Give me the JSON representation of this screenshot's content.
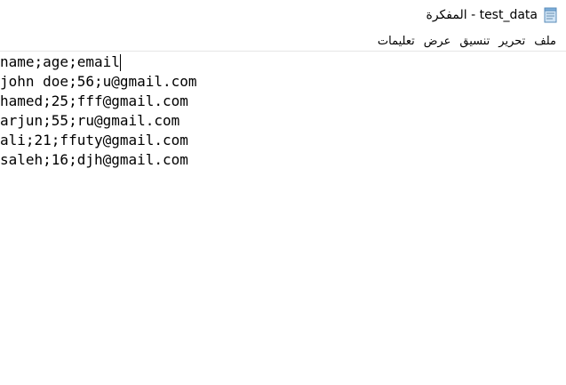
{
  "window": {
    "title": "test_data - المفكرة",
    "icon": "notepad-icon"
  },
  "menu": [
    {
      "id": "file",
      "label": "ملف"
    },
    {
      "id": "edit",
      "label": "تحرير"
    },
    {
      "id": "format",
      "label": "تنسيق"
    },
    {
      "id": "view",
      "label": "عرض"
    },
    {
      "id": "help",
      "label": "تعليمات"
    }
  ],
  "editor": {
    "lines": [
      "name;age;email",
      "john doe;56;u@gmail.com",
      "hamed;25;fff@gmail.com",
      "arjun;55;ru@gmail.com",
      "ali;21;ffuty@gmail.com",
      "saleh;16;djh@gmail.com"
    ]
  }
}
